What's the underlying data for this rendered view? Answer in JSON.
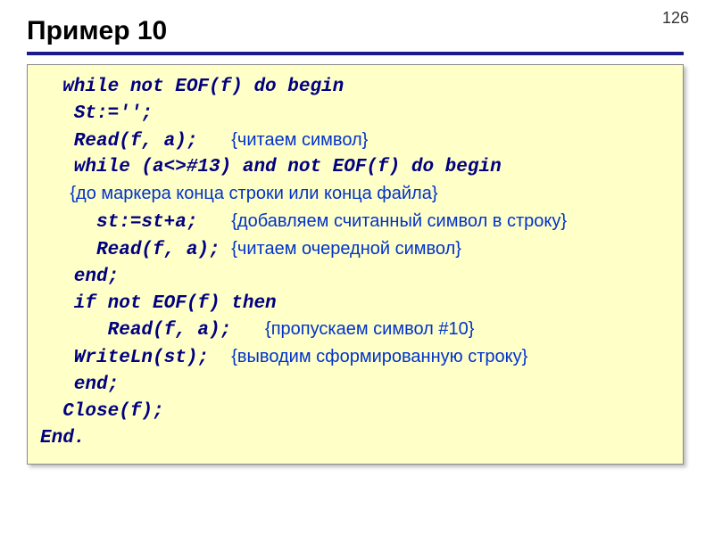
{
  "page_number": "126",
  "title": "Пример 10",
  "code": {
    "l1a": "  while not EOF(f) do begin",
    "l2a": "   St:='';",
    "l3a": "   Read(f, a);   ",
    "l3c": "{читаем символ}",
    "l4a": "   while (a<>#13) and not EOF(f) do begin",
    "l5c": "      {до маркера конца строки или конца файла}",
    "l6a": "     st:=st+a;   ",
    "l6c": "{добавляем считанный символ в строку}",
    "l7a": "     Read(f, a); ",
    "l7c": "{читаем очередной символ}",
    "l8a": "   end;",
    "l9a": "   if not EOF(f) then",
    "l10a": "      Read(f, a);   ",
    "l10c": "{пропускаем символ #10}",
    "l11a": "   WriteLn(st);  ",
    "l11c": "{выводим сформированную строку}",
    "l12a": "   end;",
    "l13a": "  Close(f);",
    "l14a": "End."
  }
}
